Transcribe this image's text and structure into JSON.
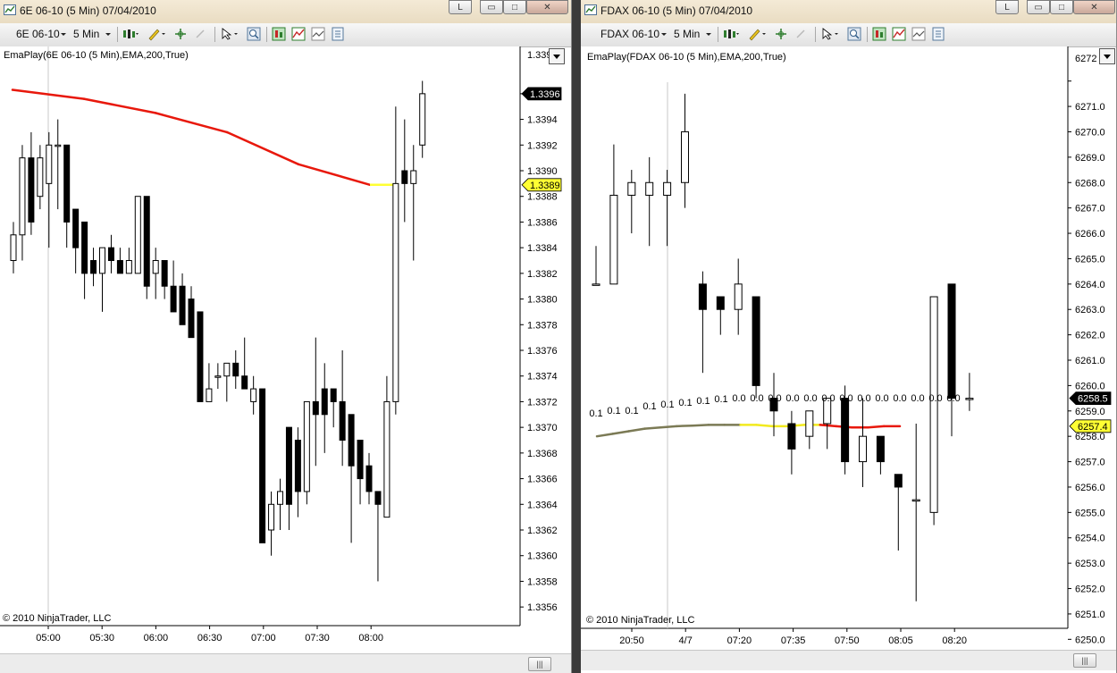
{
  "windows": [
    {
      "title": "6E 06-10 (5 Min)  07/04/2010",
      "instrument": "6E 06-10",
      "interval": "5 Min",
      "indicator_label": "EmaPlay(6E 06-10 (5 Min),EMA,200,True)",
      "copyright": "© 2010 NinjaTrader, LLC",
      "price_axis_labels": [
        "1.3396",
        "1.3394",
        "1.3392",
        "1.3390",
        "1.3388",
        "1.3386",
        "1.3384",
        "1.3382",
        "1.3380",
        "1.3378",
        "1.3376",
        "1.3374",
        "1.3372",
        "1.3370",
        "1.3368",
        "1.3366",
        "1.3364",
        "1.3362",
        "1.3360",
        "1.3358",
        "1.3356"
      ],
      "top_axis_label": "1.339",
      "last_price_tag": "1.3396",
      "ema_price_tag": "1.3389",
      "time_axis_labels": [
        "05:00",
        "05:30",
        "06:00",
        "06:30",
        "07:00",
        "07:30",
        "08:00"
      ],
      "scroll_grip": "|||",
      "colors": {
        "ema_line": "#e8180c",
        "ema_last": "#ffff33",
        "last_tag_bg": "#000000",
        "ema_tag_bg": "#ffff33"
      },
      "chart_data": {
        "type": "candlestick",
        "y_axis_range": [
          1.3355,
          1.3397
        ],
        "ema": [
          1.33963,
          1.33956,
          1.33945,
          1.3393,
          1.33905,
          1.33889
        ],
        "candles": [
          {
            "open": 1.3383,
            "high": 1.3386,
            "low": 1.3382,
            "close": 1.3385
          },
          {
            "open": 1.3385,
            "high": 1.3392,
            "low": 1.3383,
            "close": 1.3391
          },
          {
            "open": 1.3391,
            "high": 1.3393,
            "low": 1.3385,
            "close": 1.3386
          },
          {
            "open": 1.3388,
            "high": 1.3392,
            "low": 1.3387,
            "close": 1.3391
          },
          {
            "open": 1.3389,
            "high": 1.3393,
            "low": 1.3384,
            "close": 1.3392
          },
          {
            "open": 1.3392,
            "high": 1.3394,
            "low": 1.3387,
            "close": 1.3392
          },
          {
            "open": 1.3392,
            "high": 1.3392,
            "low": 1.3384,
            "close": 1.3386
          },
          {
            "open": 1.3387,
            "high": 1.3387,
            "low": 1.3382,
            "close": 1.3384
          },
          {
            "open": 1.3386,
            "high": 1.3386,
            "low": 1.338,
            "close": 1.3382
          },
          {
            "open": 1.3383,
            "high": 1.3384,
            "low": 1.3381,
            "close": 1.3382
          },
          {
            "open": 1.3382,
            "high": 1.3383,
            "low": 1.3379,
            "close": 1.3384
          },
          {
            "open": 1.3384,
            "high": 1.3385,
            "low": 1.3382,
            "close": 1.3383
          },
          {
            "open": 1.3383,
            "high": 1.3384,
            "low": 1.3382,
            "close": 1.3382
          },
          {
            "open": 1.3382,
            "high": 1.3384,
            "low": 1.3382,
            "close": 1.3383
          },
          {
            "open": 1.3382,
            "high": 1.3388,
            "low": 1.3382,
            "close": 1.3388
          },
          {
            "open": 1.3388,
            "high": 1.3388,
            "low": 1.338,
            "close": 1.3381
          },
          {
            "open": 1.3382,
            "high": 1.3384,
            "low": 1.338,
            "close": 1.3383
          },
          {
            "open": 1.3383,
            "high": 1.3383,
            "low": 1.338,
            "close": 1.3381
          },
          {
            "open": 1.3381,
            "high": 1.3383,
            "low": 1.3379,
            "close": 1.3379
          },
          {
            "open": 1.3381,
            "high": 1.3382,
            "low": 1.3378,
            "close": 1.3378
          },
          {
            "open": 1.338,
            "high": 1.3381,
            "low": 1.3377,
            "close": 1.3377
          },
          {
            "open": 1.3379,
            "high": 1.3379,
            "low": 1.3372,
            "close": 1.3372
          },
          {
            "open": 1.3372,
            "high": 1.3375,
            "low": 1.3372,
            "close": 1.3373
          },
          {
            "open": 1.3374,
            "high": 1.3375,
            "low": 1.3373,
            "close": 1.3374
          },
          {
            "open": 1.3374,
            "high": 1.3375,
            "low": 1.3372,
            "close": 1.3375
          },
          {
            "open": 1.3375,
            "high": 1.3376,
            "low": 1.3373,
            "close": 1.3374
          },
          {
            "open": 1.3374,
            "high": 1.3377,
            "low": 1.3373,
            "close": 1.3373
          },
          {
            "open": 1.3372,
            "high": 1.3374,
            "low": 1.3371,
            "close": 1.3373
          },
          {
            "open": 1.3373,
            "high": 1.3373,
            "low": 1.3361,
            "close": 1.3361
          },
          {
            "open": 1.3362,
            "high": 1.3365,
            "low": 1.336,
            "close": 1.3364
          },
          {
            "open": 1.3364,
            "high": 1.3366,
            "low": 1.3362,
            "close": 1.3365
          },
          {
            "open": 1.337,
            "high": 1.337,
            "low": 1.3362,
            "close": 1.3364
          },
          {
            "open": 1.3369,
            "high": 1.337,
            "low": 1.3363,
            "close": 1.3365
          },
          {
            "open": 1.3365,
            "high": 1.3372,
            "low": 1.3364,
            "close": 1.3372
          },
          {
            "open": 1.3372,
            "high": 1.3377,
            "low": 1.3367,
            "close": 1.3371
          },
          {
            "open": 1.3373,
            "high": 1.3375,
            "low": 1.3368,
            "close": 1.3371
          },
          {
            "open": 1.3373,
            "high": 1.3373,
            "low": 1.337,
            "close": 1.3372
          },
          {
            "open": 1.3372,
            "high": 1.3376,
            "low": 1.3367,
            "close": 1.3369
          },
          {
            "open": 1.3371,
            "high": 1.3371,
            "low": 1.3361,
            "close": 1.3367
          },
          {
            "open": 1.3369,
            "high": 1.3369,
            "low": 1.3364,
            "close": 1.3366
          },
          {
            "open": 1.3367,
            "high": 1.3368,
            "low": 1.3364,
            "close": 1.3365
          },
          {
            "open": 1.3365,
            "high": 1.3365,
            "low": 1.3358,
            "close": 1.3364
          },
          {
            "open": 1.3363,
            "high": 1.3374,
            "low": 1.3363,
            "close": 1.3372
          },
          {
            "open": 1.3372,
            "high": 1.3395,
            "low": 1.3371,
            "close": 1.3389
          },
          {
            "open": 1.339,
            "high": 1.3394,
            "low": 1.3386,
            "close": 1.3389
          },
          {
            "open": 1.3389,
            "high": 1.3392,
            "low": 1.3383,
            "close": 1.339
          },
          {
            "open": 1.3392,
            "high": 1.3397,
            "low": 1.3391,
            "close": 1.3396
          }
        ]
      }
    },
    {
      "title": "FDAX 06-10 (5 Min)  07/04/2010",
      "instrument": "FDAX 06-10",
      "interval": "5 Min",
      "indicator_label": "EmaPlay(FDAX 06-10 (5 Min),EMA,200,True)",
      "copyright": "© 2010 NinjaTrader, LLC",
      "price_axis_labels": [
        "6272",
        "6271.0",
        "6270.0",
        "6269.0",
        "6268.0",
        "6267.0",
        "6266.0",
        "6265.0",
        "6264.0",
        "6263.0",
        "6262.0",
        "6261.0",
        "6260.0",
        "6259.0",
        "6258.0",
        "6257.0",
        "6256.0",
        "6255.0",
        "6254.0",
        "6253.0",
        "6252.0",
        "6251.0",
        "6250.0"
      ],
      "last_price_tag": "6258.5",
      "ema_price_tag": "6257.4",
      "time_axis_labels": [
        "20:50",
        "4/7",
        "07:20",
        "07:35",
        "07:50",
        "08:05",
        "08:20"
      ],
      "scroll_grip": "|||",
      "colors": {
        "ema_line": "#e8180c",
        "ema_flat": "#f2ea1e",
        "ema_rising": "#7b7a55",
        "last_tag_bg": "#000000",
        "ema_tag_bg": "#ffff33"
      },
      "slope_labels": [
        "0.1",
        "0.1",
        "0.1",
        "0.1",
        "0.1",
        "0.1",
        "0.1",
        "0.1",
        "0.0",
        "0.0",
        "0.0",
        "0.0",
        "0.0",
        "0.0",
        "0.0",
        "0.0",
        "0.0",
        "0.0",
        "0.0",
        "0.0",
        "0.0"
      ],
      "chart_data": {
        "type": "candlestick",
        "y_axis_range": [
          6249.8,
          6272.0
        ],
        "ema": [
          6257.0,
          6257.1,
          6257.2,
          6257.3,
          6257.35,
          6257.4,
          6257.42,
          6257.45,
          6257.45,
          6257.45,
          6257.45,
          6257.4,
          6257.4,
          6257.45,
          6257.45,
          6257.4,
          6257.35,
          6257.35,
          6257.4,
          6257.4
        ],
        "candles": [
          {
            "open": 6263.0,
            "high": 6264.5,
            "low": 6263.0,
            "close": 6263.0
          },
          {
            "open": 6263.0,
            "high": 6268.5,
            "low": 6263.0,
            "close": 6266.5
          },
          {
            "open": 6266.5,
            "high": 6267.5,
            "low": 6265.0,
            "close": 6267.0
          },
          {
            "open": 6266.5,
            "high": 6268.0,
            "low": 6264.5,
            "close": 6267.0
          },
          {
            "open": 6266.5,
            "high": 6267.5,
            "low": 6264.5,
            "close": 6267.0
          },
          {
            "open": 6267.0,
            "high": 6270.5,
            "low": 6266.0,
            "close": 6269.0
          },
          {
            "open": 6263.0,
            "high": 6263.5,
            "low": 6259.5,
            "close": 6262.0
          },
          {
            "open": 6262.5,
            "high": 6262.5,
            "low": 6261.0,
            "close": 6262.0
          },
          {
            "open": 6262.0,
            "high": 6264.0,
            "low": 6261.0,
            "close": 6263.0
          },
          {
            "open": 6262.5,
            "high": 6262.5,
            "low": 6258.5,
            "close": 6259.0
          },
          {
            "open": 6258.5,
            "high": 6259.5,
            "low": 6257.0,
            "close": 6258.0
          },
          {
            "open": 6257.5,
            "high": 6258.0,
            "low": 6255.5,
            "close": 6256.5
          },
          {
            "open": 6257.0,
            "high": 6257.5,
            "low": 6256.5,
            "close": 6258.0
          },
          {
            "open": 6257.5,
            "high": 6258.5,
            "low": 6256.5,
            "close": 6258.5
          },
          {
            "open": 6258.5,
            "high": 6259.0,
            "low": 6255.5,
            "close": 6256.0
          },
          {
            "open": 6256.0,
            "high": 6258.5,
            "low": 6255.0,
            "close": 6257.0
          },
          {
            "open": 6257.0,
            "high": 6257.0,
            "low": 6255.5,
            "close": 6256.0
          },
          {
            "open": 6255.5,
            "high": 6255.5,
            "low": 6252.5,
            "close": 6255.0
          },
          {
            "open": 6254.5,
            "high": 6257.5,
            "low": 6250.5,
            "close": 6254.5
          },
          {
            "open": 6254.0,
            "high": 6262.5,
            "low": 6253.5,
            "close": 6262.5
          },
          {
            "open": 6263.0,
            "high": 6263.0,
            "low": 6257.0,
            "close": 6258.5
          },
          {
            "open": 6258.5,
            "high": 6259.5,
            "low": 6258.0,
            "close": 6258.5
          }
        ]
      }
    }
  ],
  "window_buttons": {
    "restore": "L",
    "minimize": "▭",
    "maximize": "□",
    "close": "✕"
  },
  "icons": [
    "chart-window-icon",
    "dropdown-arrow-icon",
    "bar-style-icon",
    "drawing-pencil-icon",
    "crosshair-icon",
    "pointer-icon",
    "zoom-icon",
    "data-box-icon",
    "indicators-icon",
    "strategies-icon",
    "properties-icon"
  ]
}
